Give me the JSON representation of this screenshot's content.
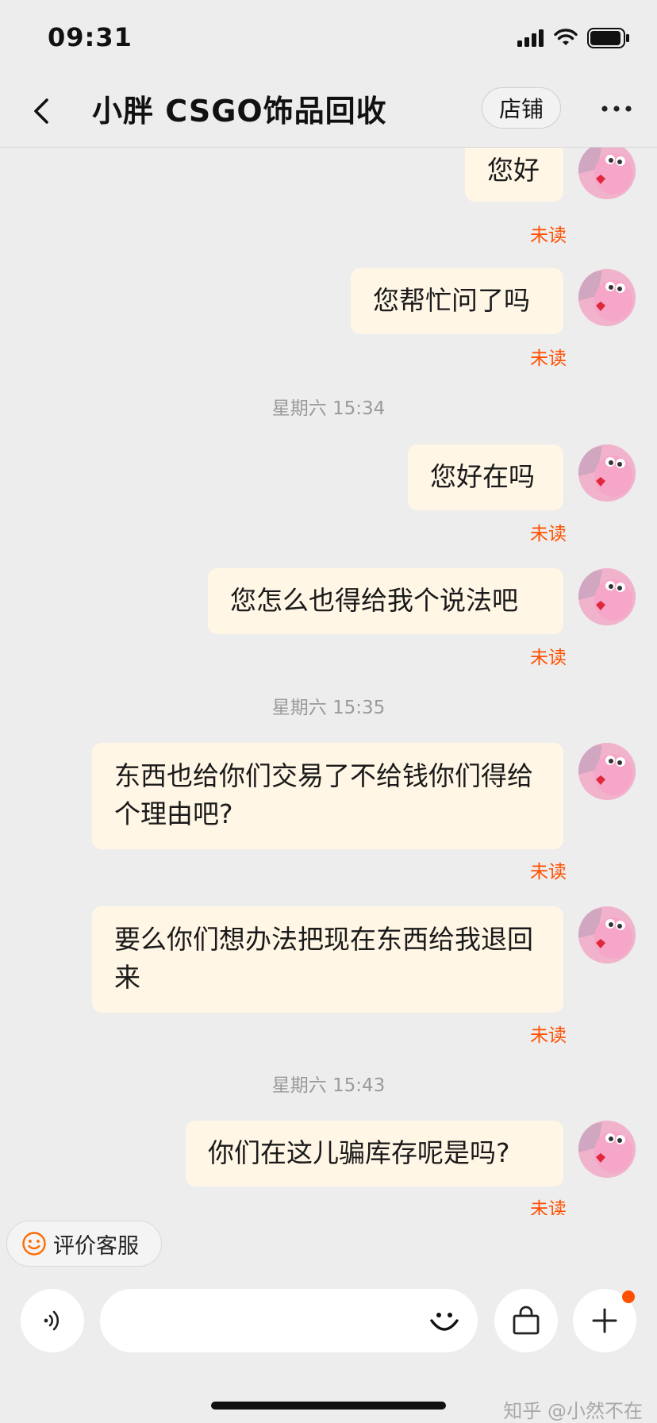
{
  "status_bar": {
    "time": "09:31"
  },
  "header": {
    "title": "小胖 CSGO饰品回收",
    "shop_label": "店铺"
  },
  "messages": [
    {
      "text": "您好",
      "status": "未读"
    },
    {
      "text": "您帮忙问了吗",
      "status": "未读"
    },
    {
      "text": "您好在吗",
      "status": "未读"
    },
    {
      "text": "您怎么也得给我个说法吧",
      "status": "未读"
    },
    {
      "text": "东西也给你们交易了不给钱你们得给个理由吧?",
      "status": "未读"
    },
    {
      "text": "要么你们想办法把现在东西给我退回来",
      "status": "未读"
    },
    {
      "text": "你们在这儿骗库存呢是吗?",
      "status": "未读"
    }
  ],
  "timestamps": [
    "星期六 15:34",
    "星期六 15:35",
    "星期六 15:43"
  ],
  "footer": {
    "rate_label": "评价客服",
    "input_placeholder": ""
  },
  "watermark": "知乎 @小然不在",
  "colors": {
    "accent": "#ff5000",
    "bubble": "#fff6e6",
    "background": "#ededed"
  },
  "icons": [
    "back-arrow-icon",
    "more-dots-icon",
    "smile-icon",
    "voice-icon",
    "emoji-icon",
    "shopping-bag-icon",
    "plus-icon"
  ]
}
